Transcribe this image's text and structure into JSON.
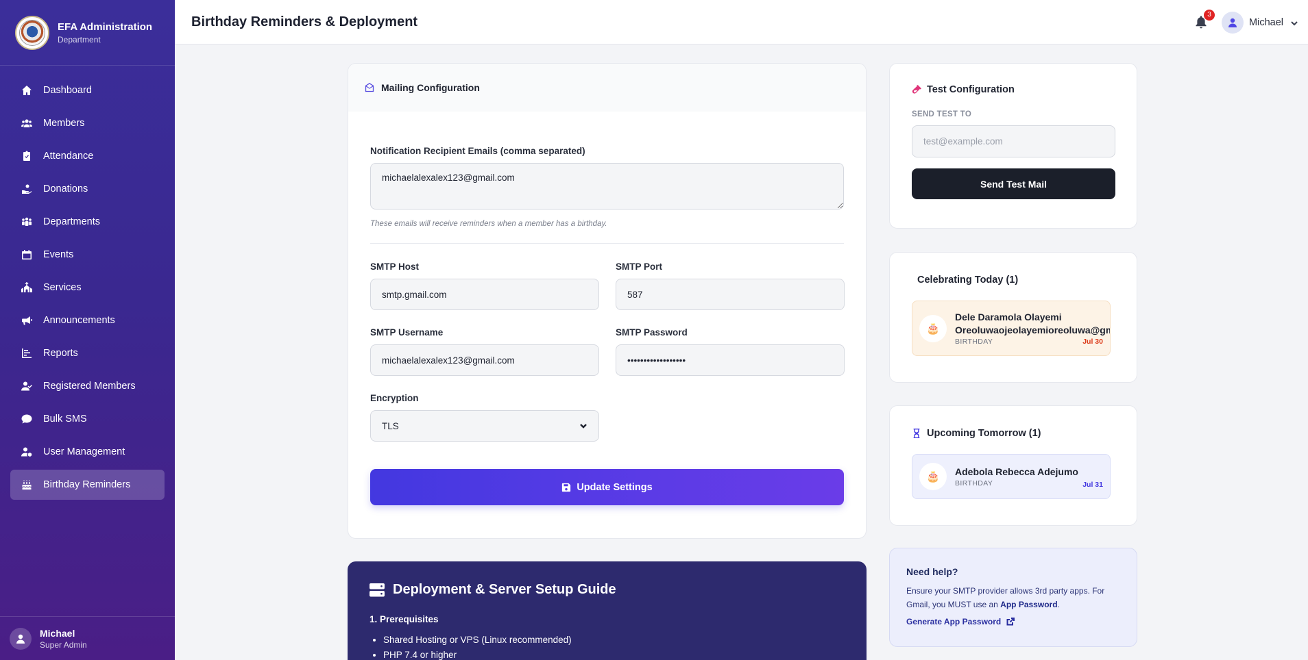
{
  "brand": {
    "title": "EFA Administration",
    "subtitle": "Department"
  },
  "sidebar": {
    "items": [
      {
        "label": "Dashboard",
        "icon": "home-icon"
      },
      {
        "label": "Members",
        "icon": "users-icon"
      },
      {
        "label": "Attendance",
        "icon": "clipboard-check-icon"
      },
      {
        "label": "Donations",
        "icon": "hand-holding-icon"
      },
      {
        "label": "Departments",
        "icon": "people-group-icon"
      },
      {
        "label": "Events",
        "icon": "calendar-icon"
      },
      {
        "label": "Services",
        "icon": "church-icon"
      },
      {
        "label": "Announcements",
        "icon": "bullhorn-icon"
      },
      {
        "label": "Reports",
        "icon": "chart-icon"
      },
      {
        "label": "Registered Members",
        "icon": "user-check-icon"
      },
      {
        "label": "Bulk SMS",
        "icon": "comment-icon"
      },
      {
        "label": "User Management",
        "icon": "user-gear-icon"
      },
      {
        "label": "Birthday Reminders",
        "icon": "cake-icon",
        "active": true
      }
    ],
    "user": {
      "name": "Michael",
      "role": "Super Admin"
    }
  },
  "header": {
    "title": "Birthday Reminders & Deployment",
    "notifications": "3",
    "user": "Michael"
  },
  "mailing": {
    "title": "Mailing Configuration",
    "recipients_label": "Notification Recipient Emails (comma separated)",
    "recipients_value": "michaelalexalex123@gmail.com",
    "recipients_hint": "These emails will receive reminders when a member has a birthday.",
    "host_label": "SMTP Host",
    "host_value": "smtp.gmail.com",
    "port_label": "SMTP Port",
    "port_value": "587",
    "username_label": "SMTP Username",
    "username_value": "michaelalexalex123@gmail.com",
    "password_label": "SMTP Password",
    "password_value": "••••••••••••••••••",
    "encryption_label": "Encryption",
    "encryption_value": "TLS",
    "update_label": "Update Settings"
  },
  "deploy": {
    "title": "Deployment & Server Setup Guide",
    "section": "1. Prerequisites",
    "items": [
      "Shared Hosting or VPS (Linux recommended)",
      "PHP 7.4 or higher"
    ]
  },
  "test": {
    "title": "Test Configuration",
    "send_to_label": "SEND TEST TO",
    "placeholder": "test@example.com",
    "button": "Send Test Mail"
  },
  "today": {
    "title": "Celebrating Today (1)",
    "name_line1": "Dele Daramola Olayemi",
    "name_line2": "Oreoluwaojeolayemioreoluwa@gmail.",
    "tag": "BIRTHDAY",
    "date": "Jul 30"
  },
  "tomorrow": {
    "title": "Upcoming Tomorrow (1)",
    "name": "Adebola Rebecca Adejumo",
    "tag": "BIRTHDAY",
    "date": "Jul 31"
  },
  "help": {
    "title": "Need help?",
    "text_pre": "Ensure your SMTP provider allows 3rd party apps. For Gmail, you MUST use an ",
    "text_bold": "App Password",
    "text_post": ".",
    "link": "Generate App Password"
  }
}
